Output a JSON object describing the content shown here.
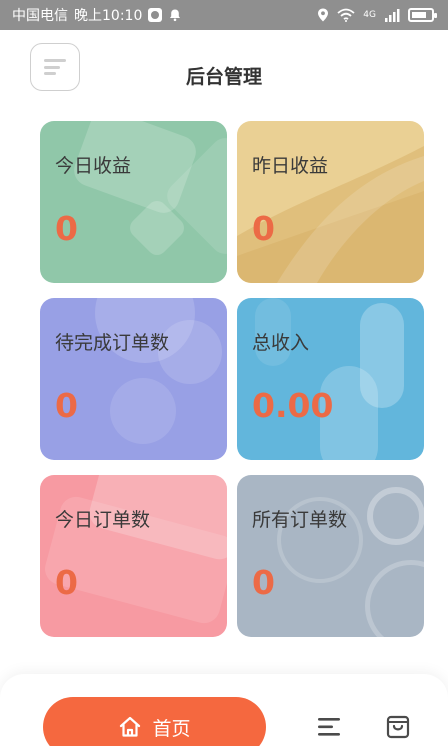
{
  "status_bar": {
    "carrier": "中国电信",
    "time": "晚上10:10",
    "signal_text": "4G",
    "battery_level": 0.8
  },
  "header": {
    "title": "后台管理",
    "menu_icon": "menu-icon"
  },
  "cards": [
    {
      "label": "今日收益",
      "value": "0"
    },
    {
      "label": "昨日收益",
      "value": "0"
    },
    {
      "label": "待完成订单数",
      "value": "0"
    },
    {
      "label": "总收入",
      "value": "0.00"
    },
    {
      "label": "今日订单数",
      "value": "0"
    },
    {
      "label": "所有订单数",
      "value": "0"
    }
  ],
  "nav": {
    "home_label": "首页",
    "home_icon": "home-icon",
    "list_icon": "list-icon",
    "bag_icon": "shopping-bag-icon"
  },
  "colors": {
    "accent": "#f5683f",
    "value_text": "#ec6a46",
    "card_green": "#90c7a9",
    "card_yellow": "#ead094",
    "card_purple": "#98a0e5",
    "card_blue": "#62b6dc",
    "card_pink": "#f79aa2",
    "card_gray": "#a9b6c4"
  }
}
